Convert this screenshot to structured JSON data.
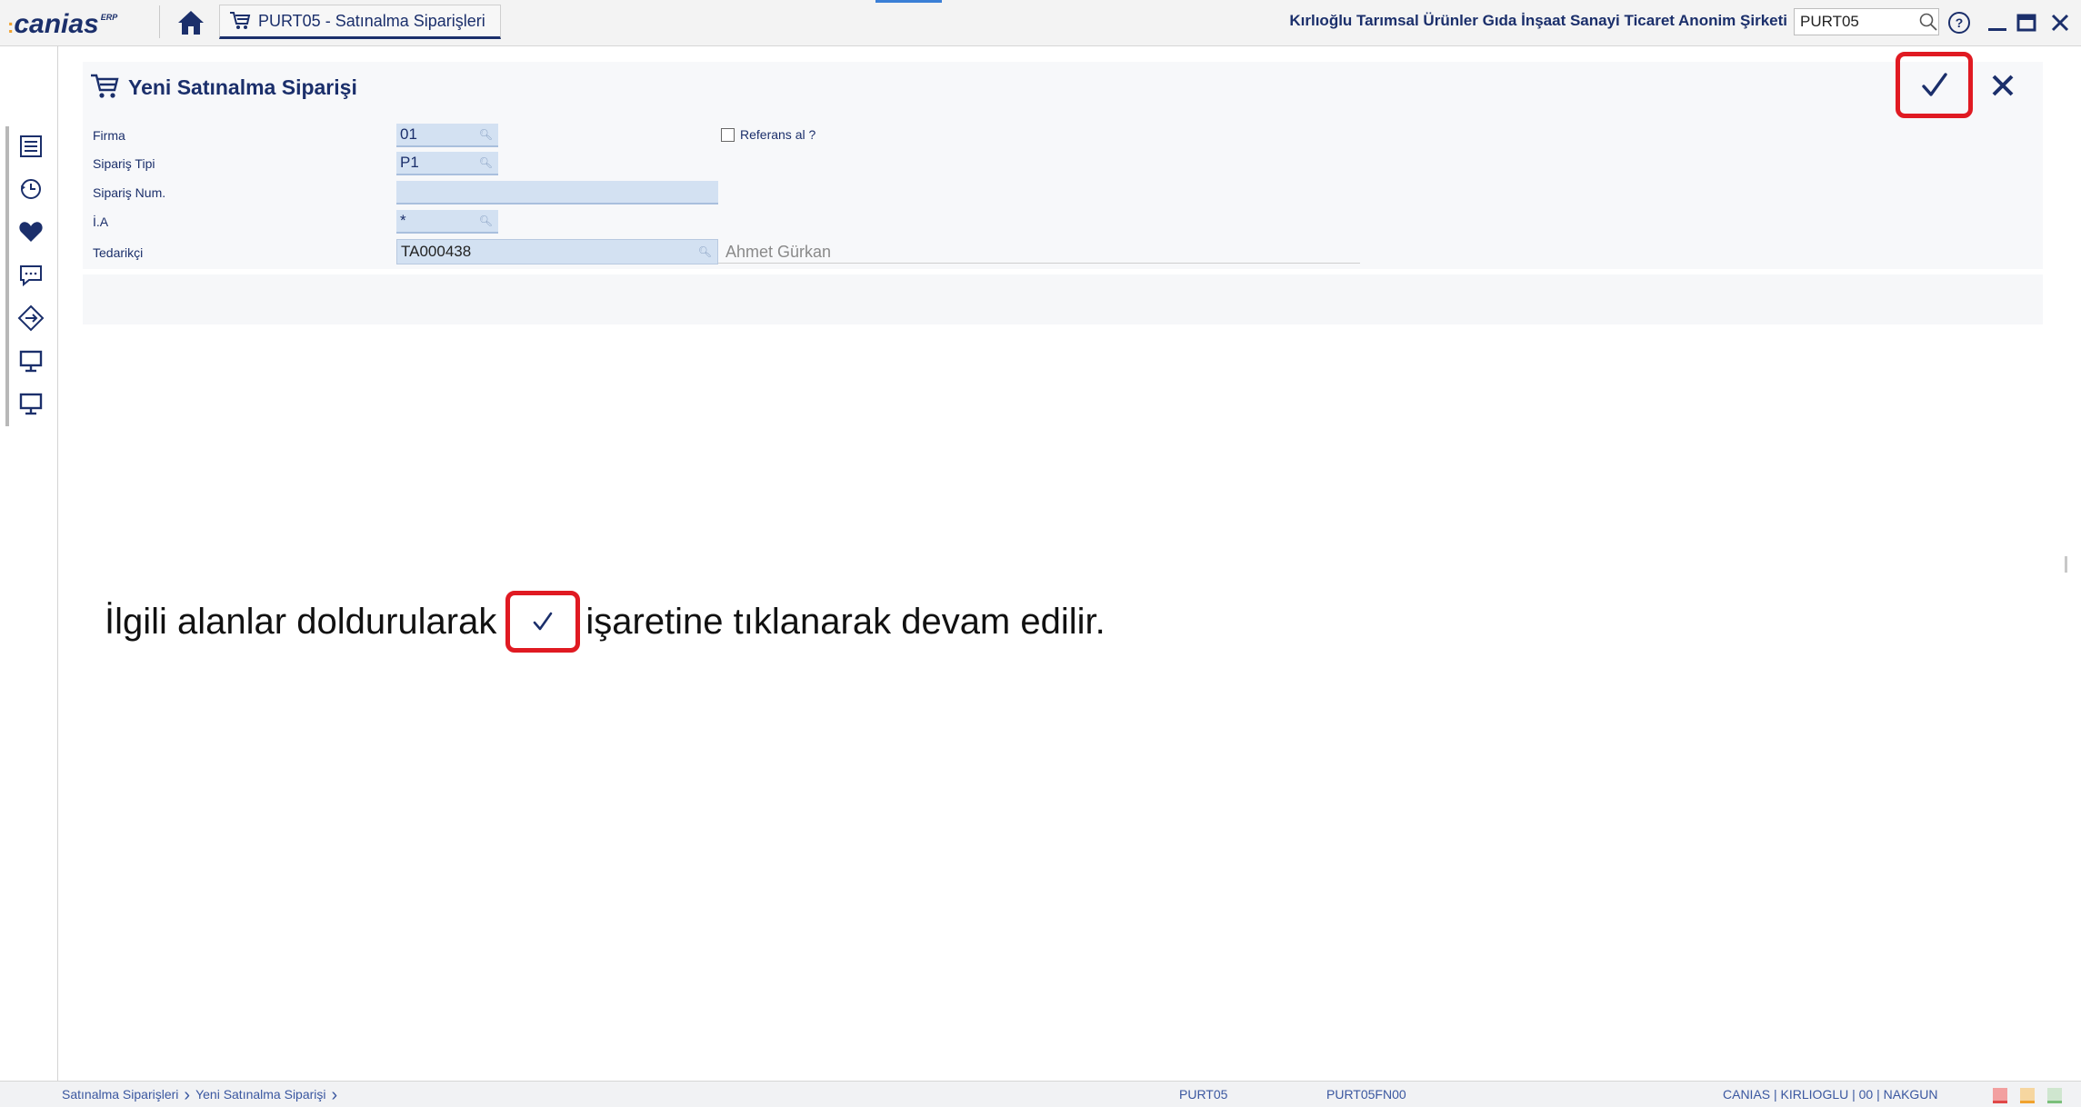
{
  "app": {
    "logo_text": "canias",
    "logo_sup": "ERP",
    "tab_label": "PURT05 - Satınalma Siparişleri",
    "company": "Kırlıoğlu Tarımsal Ürünler Gıda İnşaat Sanayi Ticaret Anonim Şirketi",
    "transaction_search_value": "PURT05"
  },
  "form": {
    "title": "Yeni Satınalma Siparişi",
    "fields": {
      "firma": {
        "label": "Firma",
        "value": "01"
      },
      "siparis_tipi": {
        "label": "Sipariş Tipi",
        "value": "P1"
      },
      "siparis_num": {
        "label": "Sipariş Num.",
        "value": ""
      },
      "ia": {
        "label": "İ.A",
        "value": "*"
      },
      "tedarikci": {
        "label": "Tedarikçi",
        "value": "TA000438",
        "name": "Ahmet Gürkan"
      }
    },
    "referans_label": "Referans al ?",
    "referans_checked": false
  },
  "instruction": {
    "before": "İlgili alanlar doldurularak",
    "after": "işaretine tıklanarak devam edilir."
  },
  "statusbar": {
    "breadcrumb": [
      "Satınalma Siparişleri",
      "Yeni Satınalma Siparişi"
    ],
    "transaction": "PURT05",
    "function": "PURT05FN00",
    "session": "CANIAS | KIRLIOGLU | 00 | NAKGUN"
  },
  "colors": {
    "brand_navy": "#1b2f6b",
    "highlight_red": "#e01a22",
    "input_fill": "#d3e1f2",
    "logo_accent": "#f0a22e"
  },
  "icons": {
    "home": "home-icon",
    "cart": "shopping-cart-icon",
    "search": "search-icon",
    "help": "help-icon",
    "minimize": "minimize-icon",
    "maximize": "maximize-icon",
    "close": "close-icon",
    "confirm": "checkmark-icon",
    "sidebar": [
      "list-icon",
      "history-icon",
      "heart-icon",
      "chat-icon",
      "navigate-icon",
      "monitor-icon",
      "monitor-icon"
    ]
  }
}
